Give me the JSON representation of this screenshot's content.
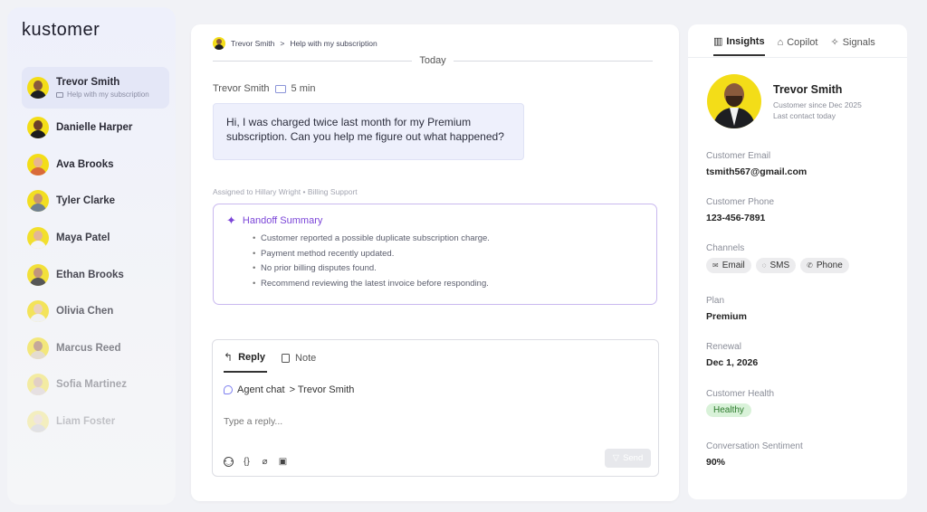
{
  "app": {
    "logo": "kustomer"
  },
  "sidebar": {
    "contacts": [
      {
        "name": "Trevor Smith",
        "subtitle": "Help with my subscription",
        "active": true,
        "skin": "#8a5a3c",
        "bg": "#f3dd18",
        "body": "#1d1e22",
        "opacity": 1
      },
      {
        "name": "Danielle Harper",
        "subtitle": "",
        "active": false,
        "skin": "#6b3f2a",
        "bg": "#f3dd18",
        "body": "#1c1c1c",
        "opacity": 1
      },
      {
        "name": "Ava Brooks",
        "subtitle": "",
        "active": false,
        "skin": "#e8b58f",
        "bg": "#f3dd18",
        "body": "#d96a3a",
        "opacity": 1
      },
      {
        "name": "Tyler Clarke",
        "subtitle": "",
        "active": false,
        "skin": "#c48f6a",
        "bg": "#f3dd18",
        "body": "#6a7a8a",
        "opacity": 0.95
      },
      {
        "name": "Maya Patel",
        "subtitle": "",
        "active": false,
        "skin": "#e2b08c",
        "bg": "#f3dd18",
        "body": "#f4f4f4",
        "opacity": 0.9
      },
      {
        "name": "Ethan Brooks",
        "subtitle": "",
        "active": false,
        "skin": "#b98567",
        "bg": "#f3dd18",
        "body": "#3b3b3b",
        "opacity": 0.85
      },
      {
        "name": "Olivia Chen",
        "subtitle": "",
        "active": false,
        "skin": "#e9c3a3",
        "bg": "#f3dd18",
        "body": "#f0f0f0",
        "opacity": 0.7
      },
      {
        "name": "Marcus Reed",
        "subtitle": "",
        "active": false,
        "skin": "#a06b4f",
        "bg": "#f3dd18",
        "body": "#d8c9b0",
        "opacity": 0.55
      },
      {
        "name": "Sofia Martinez",
        "subtitle": "",
        "active": false,
        "skin": "#c79373",
        "bg": "#f3dd18",
        "body": "#d0c0c0",
        "opacity": 0.38
      },
      {
        "name": "Liam Foster",
        "subtitle": "",
        "active": false,
        "skin": "#e4b898",
        "bg": "#f3dd18",
        "body": "#aaa",
        "opacity": 0.25
      }
    ]
  },
  "conversation": {
    "breadcrumb": {
      "name": "Trevor Smith",
      "separator": ">",
      "topic": "Help with my subscription"
    },
    "divider_label": "Today",
    "message": {
      "author": "Trevor Smith",
      "time": "5 min",
      "text": "Hi, I was charged twice last month for my Premium subscription. Can you help me figure out what happened?"
    },
    "assigned": "Assigned to Hillary Wright • Billing Support",
    "handoff": {
      "title": "Handoff Summary",
      "bullets": [
        "Customer reported a possible duplicate subscription charge.",
        "Payment method recently updated.",
        "No prior billing disputes found.",
        "Recommend reviewing the latest invoice before responding."
      ]
    },
    "composer": {
      "tab_reply": "Reply",
      "tab_note": "Note",
      "channel": "Agent chat",
      "recipient": "> Trevor Smith",
      "placeholder": "Type a reply...",
      "send_label": "Send"
    }
  },
  "insights": {
    "tabs": [
      "Insights",
      "Copilot",
      "Signals"
    ],
    "profile": {
      "name": "Trevor Smith",
      "since": "Customer since Dec 2025",
      "last_contact": "Last contact today"
    },
    "email_label": "Customer Email",
    "email": "tsmith567@gmail.com",
    "phone_label": "Customer Phone",
    "phone": "123-456-7891",
    "channels_label": "Channels",
    "channels": [
      "Email",
      "SMS",
      "Phone"
    ],
    "plan_label": "Plan",
    "plan": "Premium",
    "renewal_label": "Renewal",
    "renewal": "Dec 1, 2026",
    "health_label": "Customer Health",
    "health": "Healthy",
    "sentiment_label": "Conversation Sentiment",
    "sentiment": "90%"
  },
  "colors": {
    "accent_purple": "#7b45d8",
    "bubble_bg": "#eef0fc",
    "healthy_bg": "#d9f2d9",
    "avatar_yellow": "#f3dd18"
  }
}
